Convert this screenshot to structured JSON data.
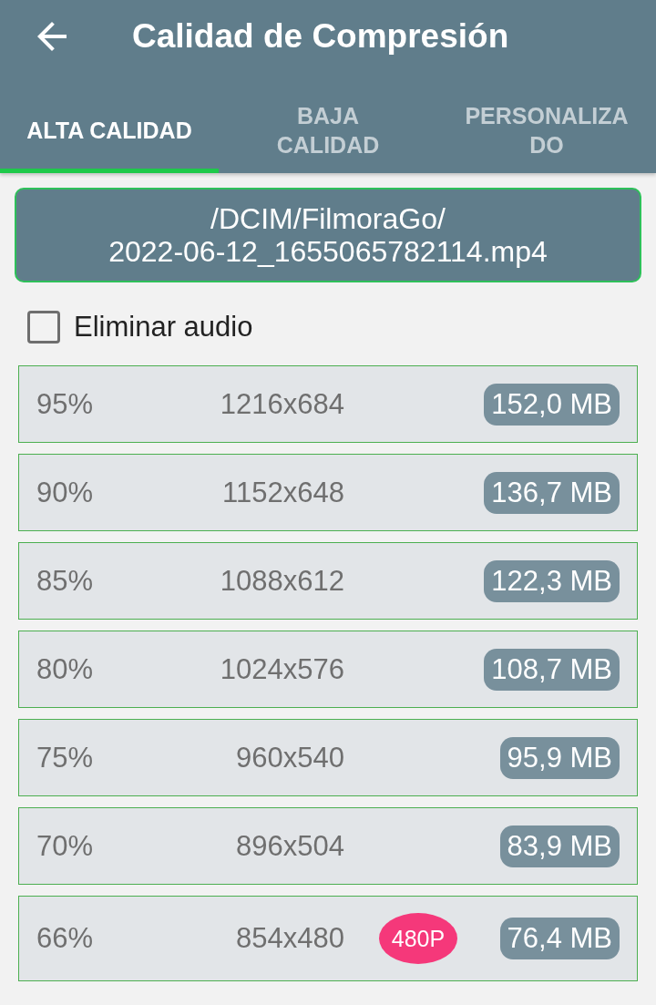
{
  "toolbar": {
    "title": "Calidad de Compresión"
  },
  "tabs": [
    {
      "label": "ALTA CALIDAD",
      "selected": true
    },
    {
      "label": "BAJA CALIDAD",
      "selected": false
    },
    {
      "label": "PERSONALIZADO",
      "selected": false
    }
  ],
  "file_path": {
    "lines": [
      "/DCIM/FilmoraGo/",
      "2022-06-12_1655065782114.mp4"
    ]
  },
  "remove_audio": {
    "label": "Eliminar audio",
    "checked": false
  },
  "options": [
    {
      "quality": "95%",
      "resolution": "1216x684",
      "size": "152,0 MB"
    },
    {
      "quality": "90%",
      "resolution": "1152x648",
      "size": "136,7 MB"
    },
    {
      "quality": "85%",
      "resolution": "1088x612",
      "size": "122,3 MB"
    },
    {
      "quality": "80%",
      "resolution": "1024x576",
      "size": "108,7 MB"
    },
    {
      "quality": "75%",
      "resolution": "960x540",
      "size": "95,9 MB"
    },
    {
      "quality": "70%",
      "resolution": "896x504",
      "size": "83,9 MB"
    },
    {
      "quality": "66%",
      "resolution": "854x480",
      "badge": "480P",
      "size": "76,4 MB"
    }
  ]
}
